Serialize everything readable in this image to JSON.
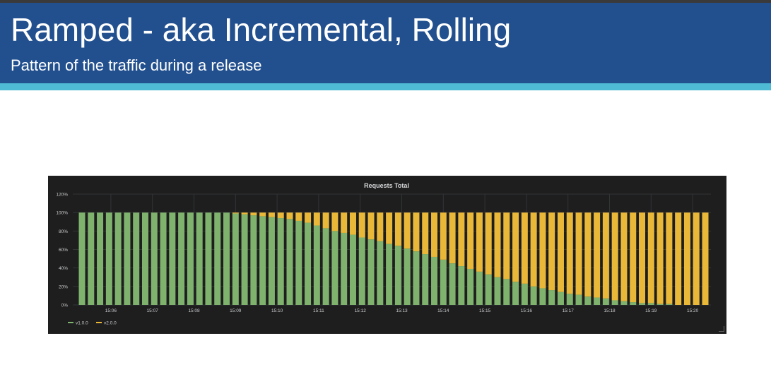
{
  "slide": {
    "title": "Ramped - aka Incremental, Rolling",
    "subtitle": "Pattern of the traffic during a release",
    "colors": {
      "header": "#22508f",
      "accent_bar": "#4fbad3"
    }
  },
  "chart_data": {
    "type": "bar",
    "stacked": true,
    "title": "Requests Total",
    "ylim": [
      0,
      120
    ],
    "yticks": [
      "0%",
      "20%",
      "40%",
      "60%",
      "80%",
      "100%",
      "120%"
    ],
    "x_tick_labels": [
      "15:06",
      "15:07",
      "15:08",
      "15:09",
      "15:10",
      "15:11",
      "15:12",
      "15:13",
      "15:14",
      "15:15",
      "15:16",
      "15:17",
      "15:18",
      "15:19",
      "15:20"
    ],
    "grid": true,
    "legend_position": "bottom-left",
    "series": [
      {
        "name": "v1.0.0",
        "color": "#7eb26d",
        "values": [
          100,
          100,
          100,
          100,
          100,
          100,
          100,
          100,
          100,
          100,
          100,
          100,
          100,
          100,
          100,
          100,
          100,
          99,
          98,
          97,
          96,
          95,
          94,
          93,
          91,
          89,
          86,
          83,
          80,
          78,
          76,
          73,
          71,
          69,
          66,
          64,
          61,
          58,
          55,
          52,
          49,
          45,
          42,
          39,
          36,
          33,
          30,
          28,
          25,
          23,
          20,
          18,
          16,
          14,
          12,
          11,
          9,
          8,
          7,
          5,
          4,
          3,
          2,
          2,
          1,
          1,
          0,
          0,
          0,
          0
        ]
      },
      {
        "name": "v2.0.0",
        "color": "#eab839",
        "values": [
          0,
          0,
          0,
          0,
          0,
          0,
          0,
          0,
          0,
          0,
          0,
          0,
          0,
          0,
          0,
          0,
          0,
          1,
          2,
          3,
          4,
          5,
          6,
          7,
          9,
          11,
          14,
          17,
          20,
          22,
          24,
          27,
          29,
          31,
          34,
          36,
          39,
          42,
          45,
          48,
          51,
          55,
          58,
          61,
          64,
          67,
          70,
          72,
          75,
          77,
          80,
          82,
          84,
          86,
          88,
          89,
          91,
          92,
          93,
          95,
          96,
          97,
          98,
          98,
          99,
          99,
          100,
          100,
          100,
          100
        ]
      }
    ]
  }
}
